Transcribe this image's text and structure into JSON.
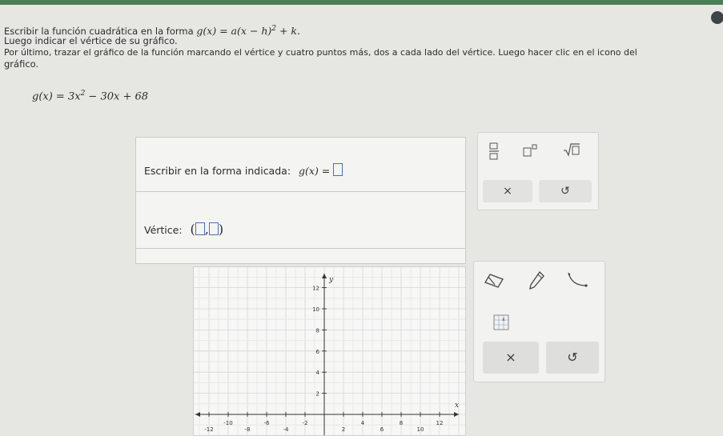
{
  "instructions": {
    "line1_text": "Escribir la función cuadrática en la forma",
    "line1_formula_pre": "g(x) = a(x − h)",
    "line1_formula_exp": "2",
    "line1_formula_post": " + k.",
    "line2": "Luego indicar el vértice de su gráfico.",
    "line3": "Por último, trazar el gráfico de la función marcando el vértice y cuatro puntos más, dos a cada lado del vértice. Luego hacer clic en el icono del",
    "line4": "gráfico."
  },
  "equation": {
    "lhs": "g(x) = 3x",
    "exp": "2",
    "rhs": " − 30x + 68"
  },
  "answer": {
    "form_label": "Escribir en la forma indicada:",
    "form_prefix": "g(x) =",
    "vertex_label": "Vértice:",
    "vertex_open": "(",
    "vertex_comma": ",",
    "vertex_close": ")"
  },
  "palette": {
    "fraction_icon": "fraction-icon",
    "superscript_icon": "superscript-icon",
    "sqrt_icon": "square-root-icon",
    "clear_label": "×",
    "undo_label": "↺"
  },
  "graph": {
    "x_axis_label": "x",
    "y_axis_label": "y",
    "x_ticks": [
      "-12",
      "-10",
      "-8",
      "-6",
      "-4",
      "-2",
      "2",
      "4",
      "6",
      "8",
      "10",
      "12"
    ],
    "x_tick_values": [
      -12,
      -10,
      -8,
      -6,
      -4,
      -2,
      2,
      4,
      6,
      8,
      10,
      12
    ],
    "y_ticks": [
      "2",
      "4",
      "6",
      "8",
      "10",
      "12"
    ],
    "y_tick_values": [
      2,
      4,
      6,
      8,
      10,
      12
    ]
  },
  "tools": {
    "eraser_icon": "eraser-icon",
    "pencil_icon": "pencil-icon",
    "parabola_icon": "parabola-icon",
    "grid_icon": "graph-grid-icon",
    "clear_label": "×",
    "undo_label": "↺"
  },
  "colors": {
    "top_bar": "#4b7d57",
    "input_border": "#4a6fb8"
  }
}
